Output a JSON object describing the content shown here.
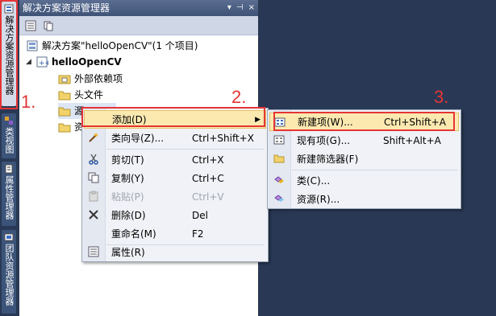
{
  "sidebar": {
    "tabs": [
      {
        "label": "解决方案资源管理器",
        "icon": "solution-explorer-icon"
      },
      {
        "label": "类视图",
        "icon": "class-view-icon"
      },
      {
        "label": "属性管理器",
        "icon": "property-manager-icon"
      },
      {
        "label": "团队资源管理器",
        "icon": "team-explorer-icon"
      }
    ]
  },
  "panel": {
    "title": "解决方案资源管理器",
    "title_buttons": [
      "▾",
      "⊣",
      "×"
    ]
  },
  "tree": {
    "solution": "解决方案\"helloOpenCV\"(1 个项目)",
    "project": "helloOpenCV",
    "items": [
      "外部依赖项",
      "头文件",
      "源文件",
      "资源文件"
    ],
    "visible_items": [
      "外部依赖项",
      "头文件",
      "源",
      "资"
    ]
  },
  "context_menu": {
    "items": [
      {
        "label": "添加(D)",
        "key": "",
        "submenu": true
      },
      {
        "label": "类向导(Z)...",
        "key": "Ctrl+Shift+X"
      },
      {
        "label": "剪切(T)",
        "key": "Ctrl+X"
      },
      {
        "label": "复制(Y)",
        "key": "Ctrl+C"
      },
      {
        "label": "粘贴(P)",
        "key": "Ctrl+V",
        "disabled": true
      },
      {
        "label": "删除(D)",
        "key": "Del"
      },
      {
        "label": "重命名(M)",
        "key": "F2"
      },
      {
        "label": "属性(R)",
        "key": ""
      }
    ]
  },
  "submenu": {
    "items": [
      {
        "label": "新建项(W)...",
        "key": "Ctrl+Shift+A"
      },
      {
        "label": "现有项(G)...",
        "key": "Shift+Alt+A"
      },
      {
        "label": "新建筛选器(F)",
        "key": ""
      },
      {
        "label": "类(C)...",
        "key": ""
      },
      {
        "label": "资源(R)...",
        "key": ""
      }
    ]
  },
  "annotations": [
    "1.",
    "2.",
    "3."
  ],
  "colors": {
    "annotation": "#e53535",
    "background": "#293955",
    "highlight": "#fbe9b0"
  }
}
